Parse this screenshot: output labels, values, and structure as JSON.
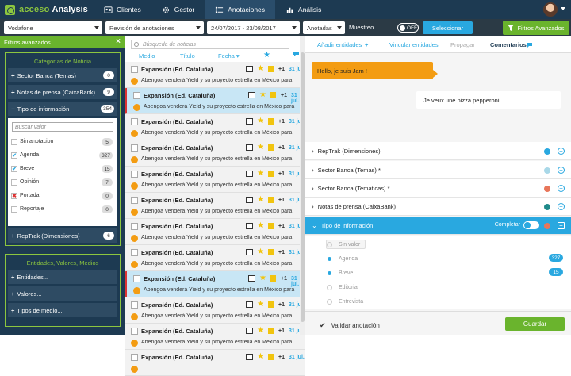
{
  "app": {
    "brand_a": "acceso",
    "brand_b": "Analysis"
  },
  "nav": [
    {
      "label": "Clientes",
      "icon": "contacts-card-icon"
    },
    {
      "label": "Gestor",
      "icon": "gear-icon"
    },
    {
      "label": "Anotaciones",
      "icon": "list-icon"
    },
    {
      "label": "Análisis",
      "icon": "bar-chart-icon"
    }
  ],
  "filters": {
    "client": "Vodafone",
    "view": "Revisión de anotaciones",
    "date_range": "24/07/2017 - 23/08/2017",
    "status": "Anotadas",
    "muestreo_label": "Muestreo",
    "muestreo_toggle": "OFF",
    "select_button": "Seleccionar",
    "advanced_button": "Filtros Avanzados"
  },
  "left": {
    "header": "Filtros avanzados",
    "close": "×",
    "categories_title": "Categorías de Noticia",
    "categories": [
      {
        "sign": "+",
        "label": "Sector Banca (Temas)",
        "count": "0"
      },
      {
        "sign": "+",
        "label": "Notas de prensa (CaixaBank)",
        "count": "9"
      },
      {
        "sign": "−",
        "label": "Tipo de información",
        "count": "354"
      }
    ],
    "sub_search_placeholder": "Buscar valor",
    "sub_options": [
      {
        "label": "Sin anotacion",
        "count": "5",
        "state": ""
      },
      {
        "label": "Agenda",
        "count": "327",
        "state": "✔"
      },
      {
        "label": "Breve",
        "count": "15",
        "state": "✔"
      },
      {
        "label": "Opinión",
        "count": "7",
        "state": ""
      },
      {
        "label": "Portada",
        "count": "0",
        "state": "✖"
      },
      {
        "label": "Reportaje",
        "count": "0",
        "state": ""
      }
    ],
    "reptrak": {
      "sign": "+",
      "label": "RepTrak (Dimensiones)",
      "count": "6"
    },
    "entities_title": "Entidades, Valores, Medios",
    "entities": [
      {
        "sign": "+",
        "label": "Entidades..."
      },
      {
        "sign": "+",
        "label": "Valores..."
      },
      {
        "sign": "+",
        "label": "Tipos de medio..."
      }
    ]
  },
  "middle": {
    "search_placeholder": "Búsqueda de noticias",
    "cols": {
      "medio": "Medio",
      "titulo": "Título",
      "fecha": "Fecha ▾"
    },
    "rows": [
      {
        "title": "Expansión (Ed. Cataluña)",
        "desc": "Abengoa venderá Yield y su proyecto estrella en México para",
        "plus": "+1",
        "date": "31 jul.",
        "selected": false
      },
      {
        "title": "Expansión (Ed. Cataluña)",
        "desc": "Abengoa venderá Yield y su proyecto estrella en México para",
        "plus": "+1",
        "date": "31 jul.",
        "selected": true
      },
      {
        "title": "Expansión (Ed. Cataluña)",
        "desc": "Abengoa venderá Yield y su proyecto estrella en México para",
        "plus": "+1",
        "date": "31 jul.",
        "selected": false
      },
      {
        "title": "Expansión (Ed. Cataluña)",
        "desc": "Abengoa venderá Yield y su proyecto estrella en México para",
        "plus": "+1",
        "date": "31 jul.",
        "selected": false
      },
      {
        "title": "Expansión (Ed. Cataluña)",
        "desc": "Abengoa venderá Yield y su proyecto estrella en México para",
        "plus": "+1",
        "date": "31 jul.",
        "selected": false
      },
      {
        "title": "Expansión (Ed. Cataluña)",
        "desc": "Abengoa venderá Yield y su proyecto estrella en México para",
        "plus": "+1",
        "date": "31 jul.",
        "selected": false
      },
      {
        "title": "Expansión (Ed. Cataluña)",
        "desc": "Abengoa venderá Yield y su proyecto estrella en México para",
        "plus": "+1",
        "date": "31 jul.",
        "selected": false
      },
      {
        "title": "Expansión (Ed. Cataluña)",
        "desc": "Abengoa venderá Yield y su proyecto estrella en México para",
        "plus": "+1",
        "date": "31 jul.",
        "selected": false
      },
      {
        "title": "Expansión (Ed. Cataluña)",
        "desc": "Abengoa venderá Yield y su proyecto estrella en México para",
        "plus": "+1",
        "date": "31 jul.",
        "selected": true
      },
      {
        "title": "Expansión (Ed. Cataluña)",
        "desc": "Abengoa venderá Yield y su proyecto estrella en México para",
        "plus": "+1",
        "date": "31 jul.",
        "selected": false
      },
      {
        "title": "Expansión (Ed. Cataluña)",
        "desc": "Abengoa venderá Yield y su proyecto estrella en México para",
        "plus": "+1",
        "date": "31 jul.",
        "selected": false
      },
      {
        "title": "Expansión (Ed. Cataluña)",
        "desc": "",
        "plus": "+1",
        "date": "31 jul.",
        "selected": false
      }
    ]
  },
  "right": {
    "tabs": {
      "add_entities": "Añadir entidades",
      "add_plus": "+",
      "link": "Vincular entidades",
      "propagate": "Propagar",
      "comments": "Comentarios"
    },
    "chat": [
      {
        "text": "Hello, je suis Jam !"
      },
      {
        "text": "Je veux une pizza pepperoni"
      }
    ],
    "accordion": [
      {
        "label": "RepTrak (Dimensiones)",
        "color": "#29a8e0"
      },
      {
        "label": "Sector Banca (Temas)  *",
        "color": "#a9d8e8"
      },
      {
        "label": "Sector Banca (Temáticas)  *",
        "color": "#e8765a"
      },
      {
        "label": "Notas de prensa (CaixaBank)",
        "color": "#1f8a8a"
      }
    ],
    "open_section": {
      "label": "Tipo de información",
      "completar": "Completar",
      "color": "#e8765a"
    },
    "sub_options": [
      {
        "label": "Sin valor",
        "count": ""
      },
      {
        "label": "Agenda",
        "count": "327"
      },
      {
        "label": "Breve",
        "count": "15"
      },
      {
        "label": "Editorial",
        "count": ""
      },
      {
        "label": "Entrevista",
        "count": ""
      }
    ],
    "validate_label": "Validar anotación",
    "save_button": "Guardar"
  },
  "colors": {
    "navy": "#1d3a52",
    "green": "#6ab42d",
    "blue": "#29a8e0",
    "orange": "#f39c12"
  }
}
